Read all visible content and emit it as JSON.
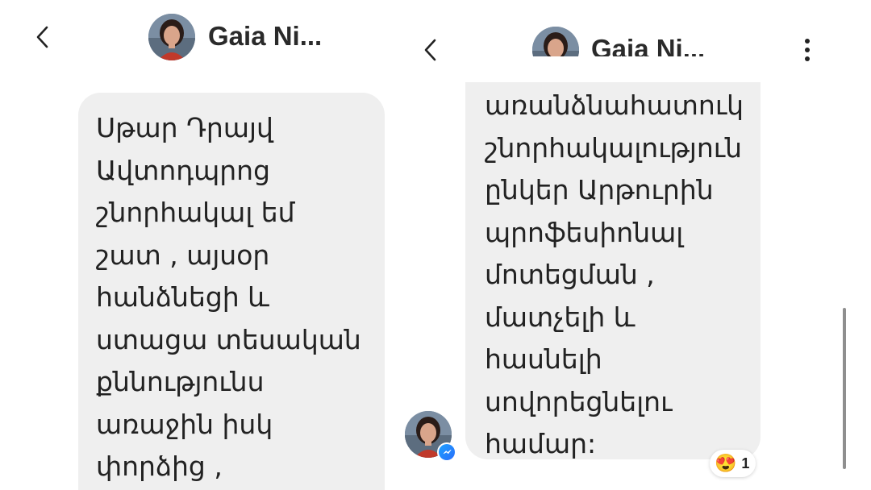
{
  "left": {
    "header": {
      "contact_name": "Gaia Ni..."
    },
    "message": {
      "lines": [
        "Սթար Դրայվ",
        "Ավտոդպրոց",
        "շնորհակալ եմ",
        "շատ  , այսօր",
        "հանձնեցի և",
        "ստացա տեսական",
        "քննությունս",
        "առաջին իսկ",
        "փորձից ,"
      ]
    }
  },
  "right": {
    "header": {
      "contact_name": "Gaia Ni..."
    },
    "message": {
      "lines": [
        "առանձնահատուկ",
        "շնորհակալություն",
        "ընկեր Արթուրին",
        "պրոֆեսիոնալ",
        "մոտեցման ,",
        "մատչելի  և",
        "հասնելի",
        "սովորեցնելու",
        "համար:"
      ],
      "reaction": {
        "emoji": "😍",
        "count": "1"
      }
    }
  },
  "icons": {
    "back": "chevron-left-icon",
    "more": "more-vertical-icon",
    "messenger_badge": "messenger-icon"
  },
  "colors": {
    "bubble_bg": "#efefef",
    "text": "#222222",
    "messenger_blue": "#1e88ff"
  }
}
